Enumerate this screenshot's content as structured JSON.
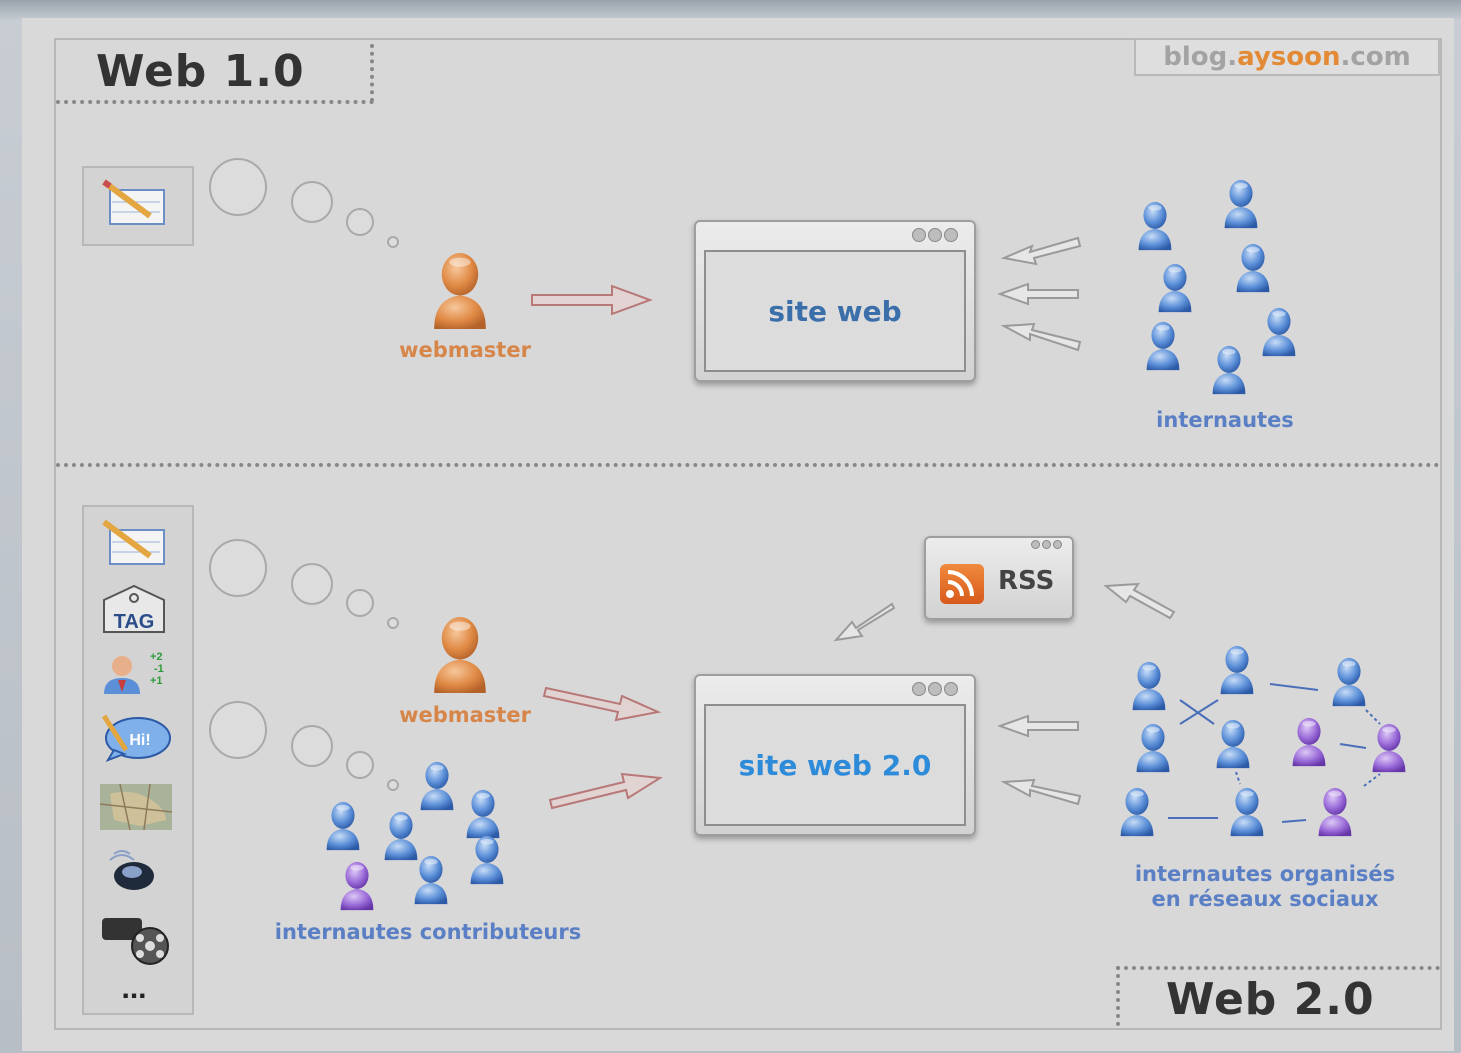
{
  "header": {
    "web1_title": "Web 1.0",
    "web2_title": "Web 2.0"
  },
  "credit": {
    "prefix": "blog.",
    "brand": "aysoon",
    "suffix": ".com"
  },
  "web1": {
    "site_label": "site web",
    "webmaster_label": "webmaster",
    "users_label": "internautes"
  },
  "web2": {
    "site_label": "site web 2.0",
    "rss_label": "RSS",
    "webmaster_label": "webmaster",
    "contributors_label": "internautes contributeurs",
    "social_label_line1": "internautes organisés",
    "social_label_line2": "en réseaux sociaux",
    "toolbox": {
      "tag_label": "TAG",
      "more_label": "...",
      "score_labels": [
        "+2",
        "-1",
        "+1"
      ],
      "chat_label": "Hi!"
    }
  },
  "colors": {
    "orange_person": "#e08a45",
    "blue_person": "#5b8fd8",
    "purple_person": "#9a6ad8",
    "arrow_red": "#b87878",
    "text_blue": "#5a7fc4",
    "brand_orange": "#e28a35"
  }
}
